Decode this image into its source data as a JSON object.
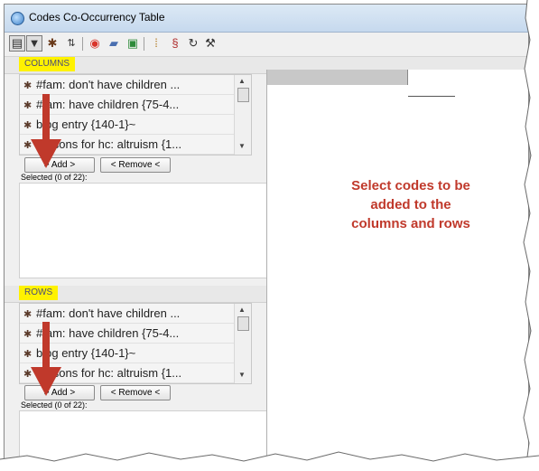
{
  "window": {
    "title": "Codes Co-Occurrency Table"
  },
  "toolbar": {
    "icons": [
      "table-view-icon",
      "filter-icon",
      "bug-icon",
      "sort-icon",
      "color-wheel-icon",
      "chat-icon",
      "export-icon",
      "split-icon",
      "code-icon",
      "refresh-icon",
      "wrench-icon"
    ]
  },
  "columns": {
    "header": "COLUMNS",
    "items": [
      "#fam: don't have children ...",
      "#fam: have children {75-4...",
      "blog entry {140-1}~",
      "reasons for hc: altruism {1..."
    ],
    "add_label": "> Add >",
    "remove_label": "< Remove <",
    "selected_label": "Selected (0 of 22):"
  },
  "rows": {
    "header": "ROWS",
    "items": [
      "#fam: don't have children ...",
      "#fam: have children {75-4...",
      "blog entry {140-1}~",
      "reasons for hc: altruism {1..."
    ],
    "add_label": "> Add >",
    "remove_label": "< Remove <",
    "selected_label": "Selected (0 of 22):"
  },
  "callout": {
    "line1": "Select codes to be",
    "line2": "added to the",
    "line3": "columns and rows"
  },
  "colors": {
    "highlight": "#fff200",
    "arrow": "#c0392b",
    "callout": "#c0392b"
  }
}
